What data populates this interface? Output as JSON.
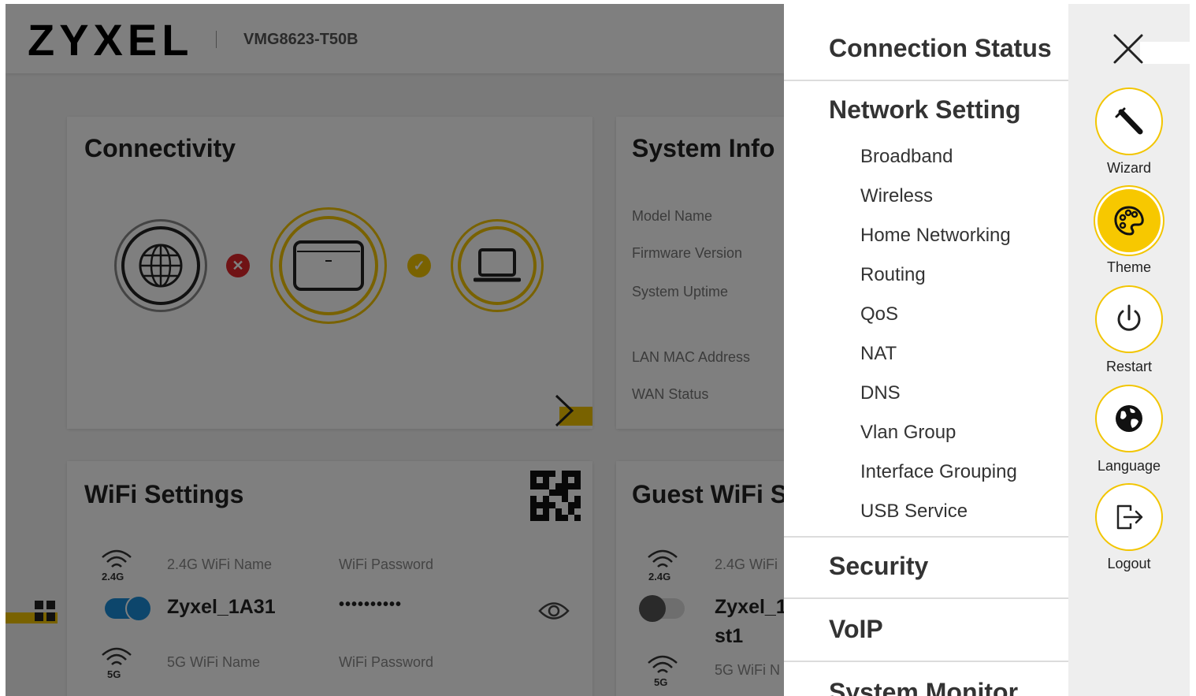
{
  "header": {
    "logo": "ZYXEL",
    "model": "VMG8623-T50B"
  },
  "connectivity": {
    "title": "Connectivity",
    "internet_status": "✕",
    "lan_status": "✓"
  },
  "system_info": {
    "title": "System Info",
    "labels": [
      "Model Name",
      "Firmware Version",
      "System Uptime",
      "LAN MAC Address",
      "WAN Status"
    ]
  },
  "wifi_settings": {
    "title": "WiFi Settings",
    "band_24": "2.4G",
    "band_5": "5G",
    "name_24_label": "2.4G WiFi Name",
    "password_label": "WiFi Password",
    "ssid_24": "Zyxel_1A31",
    "password_masked": "••••••••••",
    "name_5_label": "5G WiFi Name",
    "password_5_label": "WiFi Password",
    "toggle_24_on": true
  },
  "guest_wifi": {
    "title": "Guest WiFi S",
    "band_24": "2.4G",
    "band_5": "5G",
    "name_24_label": "2.4G WiFi",
    "ssid_line1": "Zyxel_1",
    "ssid_line2": "st1",
    "name_5_label": "5G WiFi N",
    "toggle_24_on": false
  },
  "menu": {
    "connection_status": "Connection Status",
    "network_setting": "Network Setting",
    "network_items": [
      "Broadband",
      "Wireless",
      "Home Networking",
      "Routing",
      "QoS",
      "NAT",
      "DNS",
      "Vlan Group",
      "Interface Grouping",
      "USB Service"
    ],
    "security": "Security",
    "voip": "VoIP",
    "system_monitor": "System Monitor"
  },
  "actions": {
    "wizard": "Wizard",
    "theme": "Theme",
    "restart": "Restart",
    "language": "Language",
    "logout": "Logout",
    "active": "theme"
  },
  "colors": {
    "accent": "#f2c500",
    "toggle_on": "#1a8dd8",
    "error": "#e0262b"
  }
}
